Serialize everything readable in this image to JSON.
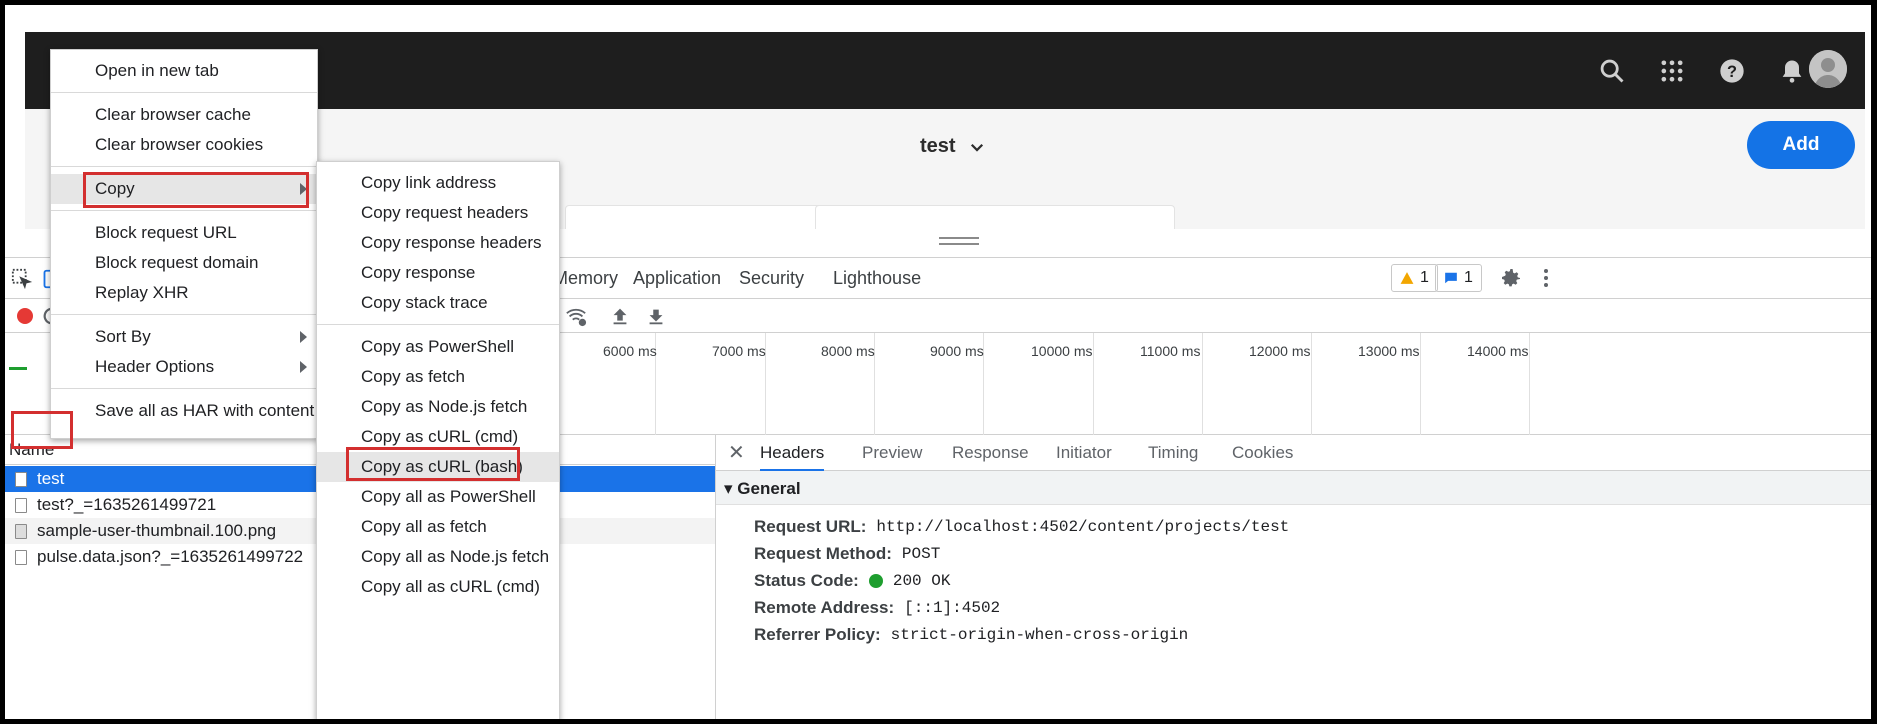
{
  "page": {
    "title": "test",
    "add_label": "Add"
  },
  "devtools": {
    "tabs": [
      "Memory",
      "Application",
      "Security",
      "Lighthouse"
    ],
    "warn_count": "1",
    "info_count": "1",
    "timeline_ticks": [
      "6000 ms",
      "7000 ms",
      "8000 ms",
      "9000 ms",
      "10000 ms",
      "11000 ms",
      "12000 ms",
      "13000 ms",
      "14000 ms"
    ],
    "name_header": "Name",
    "requests": [
      "test",
      "test?_=1635261499721",
      "sample-user-thumbnail.100.png",
      "pulse.data.json?_=1635261499722"
    ],
    "detail_tabs": [
      "Headers",
      "Preview",
      "Response",
      "Initiator",
      "Timing",
      "Cookies"
    ],
    "general_heading": "General",
    "general": {
      "request_url_key": "Request URL:",
      "request_url": "http://localhost:4502/content/projects/test",
      "method_key": "Request Method:",
      "method": "POST",
      "status_key": "Status Code:",
      "status": "200 OK",
      "remote_key": "Remote Address:",
      "remote": "[::1]:4502",
      "referrer_key": "Referrer Policy:",
      "referrer": "strict-origin-when-cross-origin"
    }
  },
  "context_menu": {
    "items": [
      "Open in new tab",
      "Clear browser cache",
      "Clear browser cookies",
      "Copy",
      "Block request URL",
      "Block request domain",
      "Replay XHR",
      "Sort By",
      "Header Options",
      "Save all as HAR with content"
    ]
  },
  "copy_submenu": {
    "items": [
      "Copy link address",
      "Copy request headers",
      "Copy response headers",
      "Copy response",
      "Copy stack trace",
      "Copy as PowerShell",
      "Copy as fetch",
      "Copy as Node.js fetch",
      "Copy as cURL (cmd)",
      "Copy as cURL (bash)",
      "Copy all as PowerShell",
      "Copy all as fetch",
      "Copy all as Node.js fetch",
      "Copy all as cURL (cmd)"
    ]
  },
  "colors": {
    "accent": "#1473e6",
    "selection": "#1a73e8",
    "highlight_box": "#d32f2f",
    "status_ok": "#1e9e2f"
  }
}
